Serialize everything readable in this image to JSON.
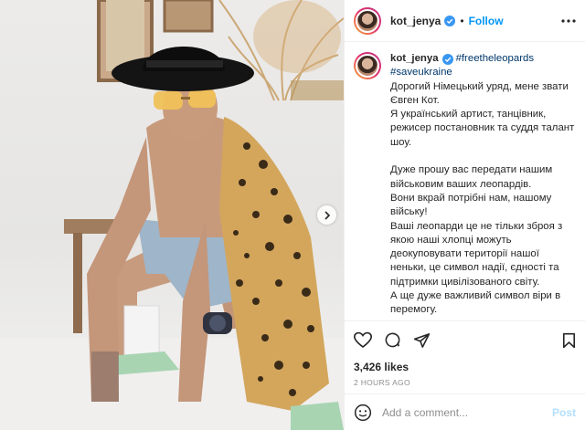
{
  "post": {
    "username": "kot_jenya",
    "follow_label": "Follow",
    "dot": "•",
    "caption": {
      "hashtag1": "#freetheleopards",
      "hashtag2": "#saveukraine",
      "text": "Дорогий Німецький уряд, мене звати Євген Кот.\nЯ український артист, танцівник, режисер постановник та суддя талант шоу.\n\nДуже прошу вас передати нашим військовим ваших леопардів.\nВони вкрай потрібні нам, нашому війську!\nВаші леопарди це не тільки зброя з якою наші хлопці можуть деокуповувати території нашої неньки, це символ надії, єдності та підтримки цивілізованого світу.\nА ще дуже важливий символ віри в перемогу."
    },
    "likes": "3,426 likes",
    "timestamp": "2 HOURS AGO",
    "comment_placeholder": "Add a comment...",
    "post_label": "Post"
  },
  "icons": {
    "verified": "verified-badge-icon",
    "more": "more-options-icon",
    "like": "heart-icon",
    "comment": "comment-icon",
    "share": "share-icon",
    "save": "bookmark-icon",
    "emoji": "emoji-icon",
    "next": "chevron-right-icon"
  },
  "colors": {
    "accent": "#0095f6",
    "verified": "#3897f0",
    "hashtag": "#00376b",
    "muted": "#8e8e8e",
    "post_disabled": "#b2dffc"
  }
}
